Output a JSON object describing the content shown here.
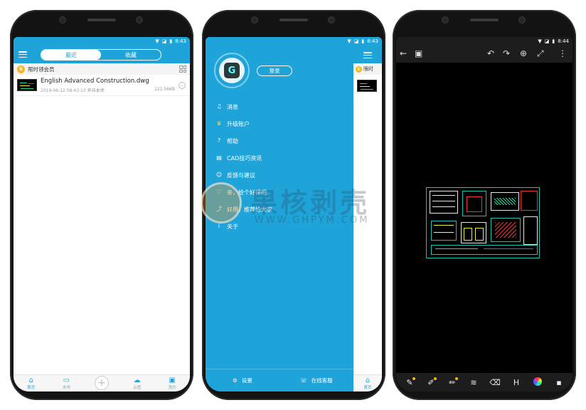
{
  "phone1": {
    "status_time": "8:43",
    "tabs": [
      {
        "label": "最近",
        "active": true
      },
      {
        "label": "收藏",
        "active": false
      }
    ],
    "vip_banner": "限时领会员",
    "files": [
      {
        "name": "English Advanced Construction.dwg",
        "date": "2019-06-12 08:43:13",
        "source": "来自本地",
        "size": "122.56KB"
      }
    ],
    "bottom_nav": [
      {
        "label": "首页",
        "icon": "home-icon",
        "glyph": "⌂"
      },
      {
        "label": "本地",
        "icon": "folder-icon",
        "glyph": "▭"
      },
      {
        "label": "",
        "icon": "plus-icon",
        "glyph": "+"
      },
      {
        "label": "云图",
        "icon": "cloud-icon",
        "glyph": "☁"
      },
      {
        "label": "我的",
        "icon": "profile-icon",
        "glyph": "▣"
      }
    ]
  },
  "phone2": {
    "status_time": "8:43",
    "login_label": "登录",
    "menu": [
      {
        "label": "消息",
        "icon": "bell-icon",
        "glyph": "♫"
      },
      {
        "label": "升级账户",
        "icon": "crown-icon",
        "glyph": "♛"
      },
      {
        "label": "帮助",
        "icon": "help-icon",
        "glyph": "?"
      },
      {
        "label": "CAD技巧资讯",
        "icon": "book-icon",
        "glyph": "▤"
      },
      {
        "label": "反馈与建议",
        "icon": "feedback-icon",
        "glyph": "☺"
      },
      {
        "label": "亲，给个好评吧",
        "icon": "thumb-icon",
        "glyph": "♡"
      },
      {
        "label": "好用，推荐给大家",
        "icon": "share-icon",
        "glyph": "⤴"
      },
      {
        "label": "关于",
        "icon": "info-icon",
        "glyph": "i"
      }
    ],
    "footer": [
      {
        "label": "设置",
        "icon": "settings-icon",
        "glyph": "⚙"
      },
      {
        "label": "在线客服",
        "icon": "support-icon",
        "glyph": "☏"
      }
    ],
    "peek_vip": "限时",
    "peek_nav": "首页"
  },
  "watermark": {
    "cn": "果核剥壳",
    "en": "WWW.GHPYM.COM"
  },
  "phone3": {
    "status_time": "8:44",
    "toolbar_top": [
      {
        "icon": "back-icon",
        "glyph": "←"
      },
      {
        "icon": "save-icon",
        "glyph": "▣"
      },
      {
        "icon": "undo-icon",
        "glyph": "↶"
      },
      {
        "icon": "redo-icon",
        "glyph": "↷"
      },
      {
        "icon": "zoom-icon",
        "glyph": "⊕"
      },
      {
        "icon": "fullscreen-icon",
        "glyph": "⤢"
      },
      {
        "icon": "more-icon",
        "glyph": "⋮"
      }
    ],
    "toolbar_bottom": [
      {
        "icon": "annotate-icon",
        "glyph": "✎"
      },
      {
        "icon": "edit-icon",
        "glyph": "✐"
      },
      {
        "icon": "pencil-icon",
        "glyph": "✏"
      },
      {
        "icon": "layers-icon",
        "glyph": "≋"
      },
      {
        "icon": "eraser-icon",
        "glyph": "⌫"
      },
      {
        "icon": "measure-icon",
        "glyph": "H"
      },
      {
        "icon": "color-wheel-icon",
        "glyph": ""
      },
      {
        "icon": "toolbox-icon",
        "glyph": "▪"
      }
    ]
  }
}
